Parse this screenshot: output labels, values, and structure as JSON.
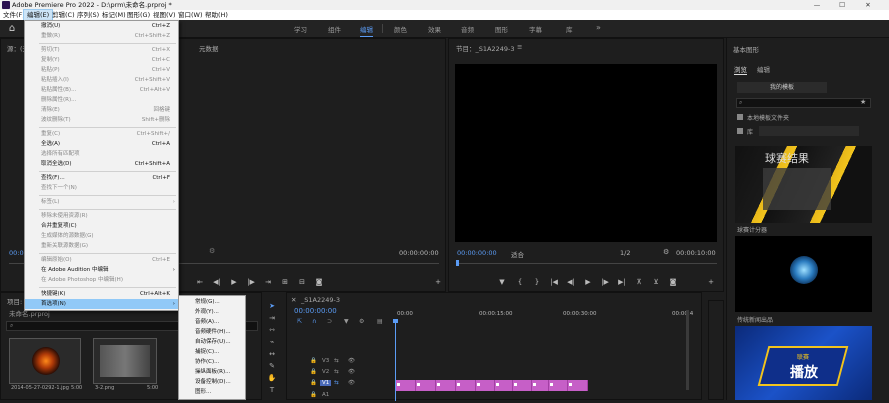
{
  "titlebar": {
    "title": "Adobe Premiere Pro 2022 - D:\\prm\\未命名.prproj *",
    "minimize": "—",
    "maximize": "☐",
    "close": "✕"
  },
  "menubar": [
    "文件(F)",
    "编辑(E)",
    "剪辑(C)",
    "序列(S)",
    "标记(M)",
    "图形(G)",
    "视图(V)",
    "窗口(W)",
    "帮助(H)"
  ],
  "workspaces": [
    "学习",
    "组件",
    "编辑",
    "颜色",
    "效果",
    "音频",
    "图形",
    "字幕",
    "库"
  ],
  "workspace_more": "»",
  "source": {
    "title": "元数据",
    "tab": "源：(无剪辑)",
    "timecode": "00:00:00:00",
    "timecode_right": "00:00:00:00"
  },
  "program": {
    "title": "节目：_S1A2249-3",
    "menu": "≡",
    "timecode": "00:00:00:00",
    "fit": "适合",
    "ratio": "1/2",
    "duration": "00:00:10:00"
  },
  "project": {
    "title": "项目: 未命名",
    "file": "未命名.prproj",
    "items": [
      {
        "name": "2014-05-27-0292-1.jpg",
        "dur": "5:00"
      },
      {
        "name": "3-2.png",
        "dur": "5:00"
      }
    ]
  },
  "timeline": {
    "seq_title": "_S1A2249-3",
    "timecode": "00:00:00:00",
    "ruler": [
      "00:00",
      "00:00:15:00",
      "00:00:30:00",
      "00:00:4"
    ],
    "tracks": [
      "V3",
      "V2",
      "V1",
      "A1"
    ]
  },
  "essential": {
    "title": "基本图形",
    "tab_browse": "浏览",
    "tab_edit": "编辑",
    "my_templates": "我的模板",
    "local_folder": "本地模板文件夹",
    "library": "库",
    "thumb1_caption": "球赛计分器",
    "thumb1_title": "球赛结果",
    "thumb2_caption": "传统新闻出品",
    "thumb3_text1": "联赛",
    "thumb3_text2": "播放"
  },
  "edit_menu": {
    "items": [
      {
        "label": "撤消(U)",
        "sc": "Ctrl+Z"
      },
      {
        "label": "重做(R)",
        "sc": "Ctrl+Shift+Z",
        "dis": true
      },
      {
        "label": "剪切(T)",
        "sc": "Ctrl+X",
        "dis": true
      },
      {
        "label": "复制(Y)",
        "sc": "Ctrl+C",
        "dis": true
      },
      {
        "label": "粘贴(P)",
        "sc": "Ctrl+V",
        "dis": true
      },
      {
        "label": "粘贴插入(I)",
        "sc": "Ctrl+Shift+V",
        "dis": true
      },
      {
        "label": "粘贴属性(B)...",
        "sc": "Ctrl+Alt+V",
        "dis": true
      },
      {
        "label": "删除属性(R)...",
        "sc": "",
        "dis": true
      },
      {
        "label": "清除(E)",
        "sc": "回格键",
        "dis": true
      },
      {
        "label": "波纹删除(T)",
        "sc": "Shift+删除",
        "dis": true
      },
      {
        "label": "重复(C)",
        "sc": "Ctrl+Shift+/",
        "dis": true
      },
      {
        "label": "全选(A)",
        "sc": "Ctrl+A"
      },
      {
        "label": "选择所有匹配项",
        "sc": "",
        "dis": true
      },
      {
        "label": "取消全选(D)",
        "sc": "Ctrl+Shift+A"
      },
      {
        "label": "查找(F)...",
        "sc": "Ctrl+F"
      },
      {
        "label": "查找下一个(N)",
        "sc": "",
        "dis": true
      },
      {
        "label": "标签(L)",
        "sc": "",
        "dis": true
      },
      {
        "label": "移除未使用资源(R)",
        "sc": "",
        "dis": true
      },
      {
        "label": "合并重复项(C)",
        "sc": ""
      },
      {
        "label": "生成媒体的源数据(G)",
        "sc": "",
        "dis": true
      },
      {
        "label": "重新关联源数据(G)",
        "sc": "",
        "dis": true
      },
      {
        "label": "编辑原始(O)",
        "sc": "Ctrl+E",
        "dis": true
      },
      {
        "label": "在 Adobe Audition 中编辑",
        "sc": ""
      },
      {
        "label": "在 Adobe Photoshop 中编辑(H)",
        "sc": "",
        "dis": true
      },
      {
        "label": "快捷键(K)",
        "sc": "Ctrl+Alt+K"
      },
      {
        "label": "首选项(N)",
        "sc": "",
        "hl": true
      }
    ]
  },
  "pref_submenu": [
    "常规(G)...",
    "外观(Y)...",
    "音频(A)...",
    "音频硬件(H)...",
    "自动保存(U)...",
    "捕捉(C)...",
    "协作(C)...",
    "操纵面板(R)...",
    "设备控制(D)...",
    "图形..."
  ]
}
